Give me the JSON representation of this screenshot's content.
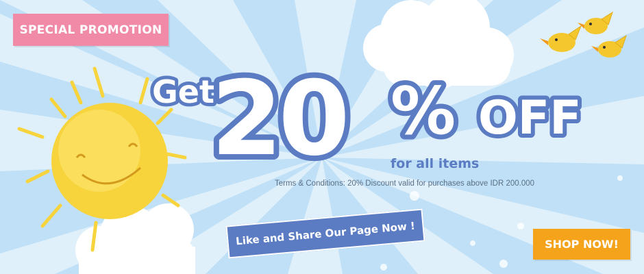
{
  "promo": {
    "tag": "SPECIAL PROMOTION"
  },
  "headline": {
    "get": "Get",
    "amount": "20",
    "percent": "%",
    "off": "OFF",
    "sub": "for all items"
  },
  "terms": "Terms & Conditions: 20% Discount valid for purchases above IDR 200.000",
  "buttons": {
    "like": "Like and Share Our Page Now !",
    "shop": "SHOP NOW!"
  },
  "colors": {
    "sky": "#bfe0f6",
    "ray": "#dff0fb",
    "outline": "#5b7cc3",
    "promo_tag": "#f18aa7",
    "shop_button": "#f6a31c",
    "sun": "#f7d33c",
    "bird": "#f5c72e"
  },
  "icons": {
    "sun": "smiling-sun-icon",
    "birds": "bird-icon",
    "clouds": "cloud-icon"
  }
}
